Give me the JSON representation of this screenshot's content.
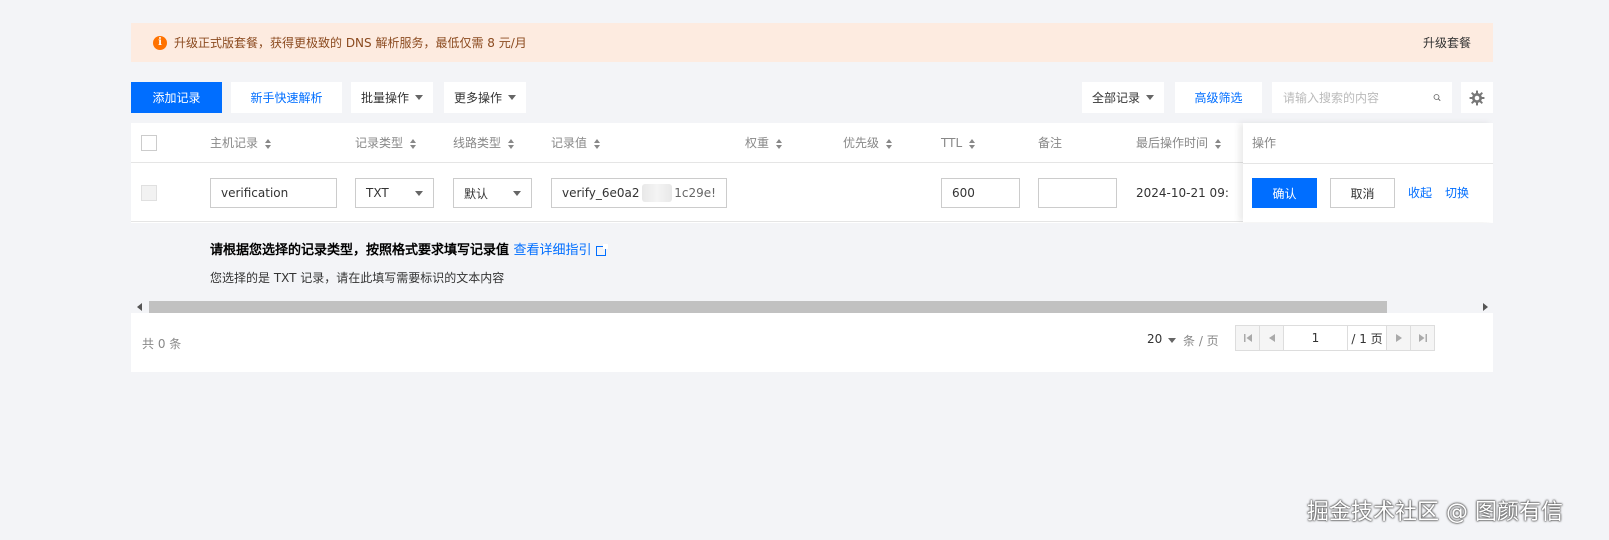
{
  "banner": {
    "icon": "info-icon",
    "text": "升级正式版套餐，获得更极致的 DNS 解析服务，最低仅需 8 元/月",
    "link": "升级套餐"
  },
  "toolbar": {
    "add_record": "添加记录",
    "quick_setup": "新手快速解析",
    "batch_ops": "批量操作",
    "more_ops": "更多操作",
    "record_filter": "全部记录",
    "advanced_filter": "高级筛选",
    "search_placeholder": "请输入搜索的内容",
    "search_icon": "search-icon",
    "settings_icon": "gear-icon"
  },
  "table": {
    "headers": {
      "host": "主机记录",
      "type": "记录类型",
      "line": "线路类型",
      "value": "记录值",
      "weight": "权重",
      "priority": "优先级",
      "ttl": "TTL",
      "remark": "备注",
      "last_op_time": "最后操作时间",
      "actions": "操作"
    },
    "edit_row": {
      "host": "verification",
      "type": "TXT",
      "line": "默认",
      "value_start": "verify_6e0a2",
      "value_end": "1c29e!",
      "ttl": "600",
      "remark": "",
      "time": "2024-10-21 09:",
      "confirm": "确认",
      "cancel": "取消",
      "collapse": "收起",
      "switch": "切换"
    }
  },
  "hint": {
    "title": "请根据您选择的记录类型，按照格式要求填写记录值",
    "link": "查看详细指引",
    "subtitle": "您选择的是 TXT 记录，请在此填写需要标识的文本内容"
  },
  "footer": {
    "total": "共 0 条",
    "page_size": "20",
    "page_size_unit": "条 / 页",
    "current_page": "1",
    "total_pages": "/ 1 页"
  },
  "watermark": "掘金技术社区 @ 图颜有信",
  "colors": {
    "primary": "#006eff",
    "banner_bg": "#fdebe0",
    "banner_icon": "#ff7200"
  }
}
